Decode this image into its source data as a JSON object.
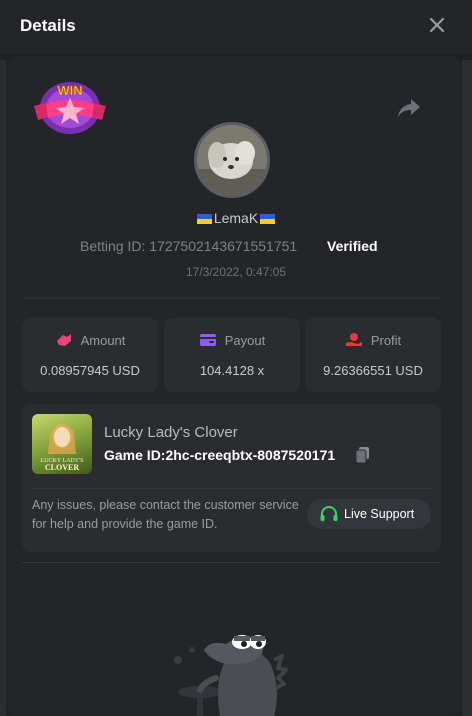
{
  "header": {
    "title": "Details"
  },
  "hero": {
    "badge_text": "WIN",
    "username": "LemaK",
    "betting_id_label": "Betting ID:",
    "betting_id": "1727502143671551751",
    "verified": "Verified",
    "timestamp": "17/3/2022, 0:47:05"
  },
  "stats": {
    "amount": {
      "label": "Amount",
      "value": "0.08957945 USD"
    },
    "payout": {
      "label": "Payout",
      "value": "104.4128 x"
    },
    "profit": {
      "label": "Profit",
      "value": "9.26366551 USD"
    }
  },
  "game": {
    "name": "Lucky Lady's Clover",
    "id_label": "Game ID:",
    "id": "2hc-creeqbtx-8087520171",
    "thumb_text_1": "LUCKY LADY'S",
    "thumb_text_2": "CLOVER"
  },
  "support": {
    "text": "Any issues, please contact the customer service for help and provide the game ID.",
    "button_label": "Live Support"
  },
  "colors": {
    "amount_icon": "#e8457a",
    "payout_icon": "#8b5cf6",
    "profit_icon": "#e83a3a",
    "support_icon": "#3bd16f"
  }
}
